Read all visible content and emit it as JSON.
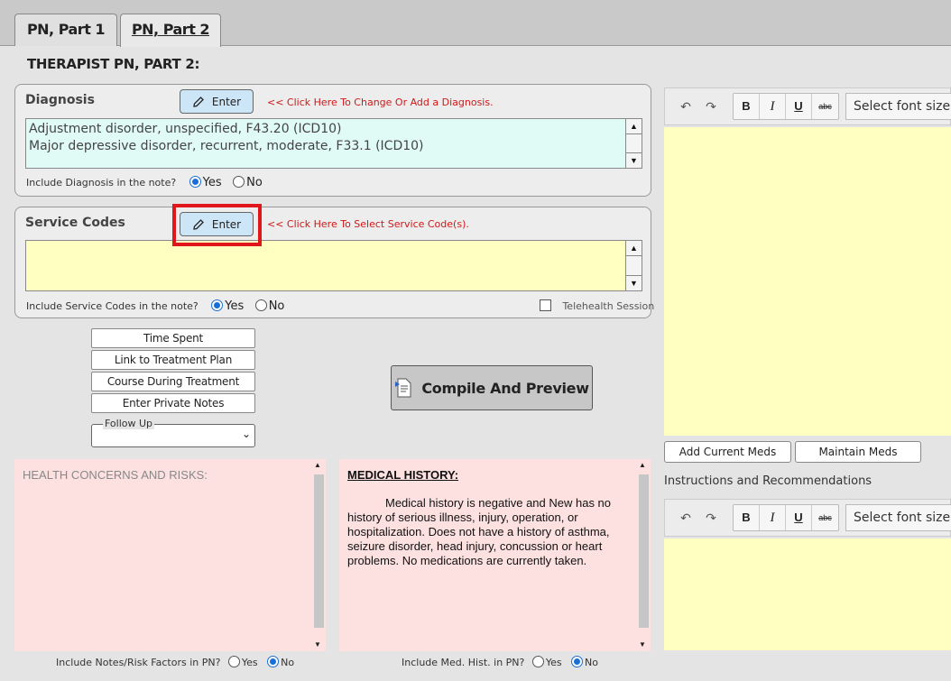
{
  "tabs": [
    {
      "label": "PN, Part 1",
      "active": false
    },
    {
      "label": "PN, Part 2",
      "active": true
    }
  ],
  "page_title": "THERAPIST PN, PART 2:",
  "diagnosis": {
    "label": "Diagnosis",
    "enter_label": "Enter",
    "hint": "<< Click Here To Change Or Add a Diagnosis.",
    "items": [
      "Adjustment disorder, unspecified, F43.20 (ICD10)",
      "Major depressive disorder, recurrent, moderate, F33.1 (ICD10)"
    ],
    "include_label": "Include Diagnosis in the note?",
    "yes": "Yes",
    "no": "No",
    "selected": "Yes"
  },
  "service_codes": {
    "label": "Service Codes",
    "enter_label": "Enter",
    "hint": "<< Click Here To Select Service Code(s).",
    "include_label": "Include Service Codes in the note?",
    "yes": "Yes",
    "no": "No",
    "selected": "Yes",
    "telehealth_label": "Telehealth Session",
    "telehealth_checked": false
  },
  "side_buttons": [
    "Time Spent",
    "Link to Treatment Plan",
    "Course During Treatment",
    "Enter Private Notes"
  ],
  "follow_up": {
    "legend": "Follow Up",
    "value": ""
  },
  "compile_label": "Compile And Preview",
  "health_concerns": {
    "placeholder": "HEALTH CONCERNS AND RISKS:",
    "include_label": "Include Notes/Risk Factors in PN?",
    "yes": "Yes",
    "no": "No",
    "selected": "No"
  },
  "medical_history": {
    "heading": "MEDICAL HISTORY:",
    "body": "Medical history is negative and New has no history of serious illness, injury, operation, or hospitalization.  Does not have a history of asthma, seizure disorder, head injury, concussion or heart problems.  No medications are currently taken.",
    "include_label": "Include Med. Hist. in PN?",
    "yes": "Yes",
    "no": "No",
    "selected": "No"
  },
  "editor": {
    "font_size_placeholder": "Select font size",
    "bold": "B",
    "italic": "I",
    "underline": "U",
    "strike": "abc",
    "undo": "↶",
    "redo": "↷"
  },
  "med_buttons": {
    "add": "Add Current Meds",
    "maintain": "Maintain Meds"
  },
  "instructions_label": "Instructions and Recommendations",
  "colors": {
    "accent_blue": "#1a6fd6",
    "highlight_red": "#e0161b",
    "editor_yellow": "#ffffc2",
    "diagnosis_bg": "#e0fbf6",
    "pink_bg": "#fde0e0"
  }
}
